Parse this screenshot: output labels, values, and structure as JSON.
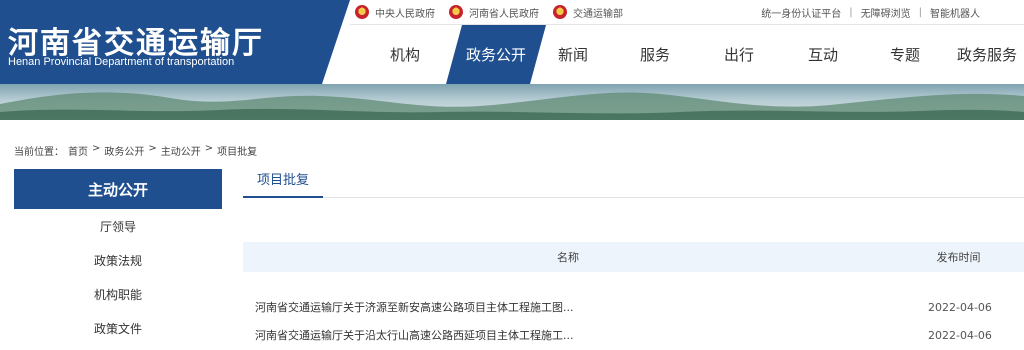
{
  "header": {
    "site_title": "河南省交通运输厅",
    "site_subtitle": "Henan Provincial Department of transportation",
    "top_links": [
      {
        "label": "中央人民政府",
        "icon": "national-emblem-icon"
      },
      {
        "label": "河南省人民政府",
        "icon": "national-emblem-icon"
      },
      {
        "label": "交通运输部",
        "icon": "national-emblem-icon"
      }
    ],
    "top_right": [
      "统一身份认证平台",
      "无障碍浏览",
      "智能机器人"
    ],
    "nav": [
      {
        "label": "机构",
        "active": false
      },
      {
        "label": "政务公开",
        "active": true
      },
      {
        "label": "新闻",
        "active": false
      },
      {
        "label": "服务",
        "active": false
      },
      {
        "label": "出行",
        "active": false
      },
      {
        "label": "互动",
        "active": false
      },
      {
        "label": "专题",
        "active": false
      },
      {
        "label": "政务服务",
        "active": false
      }
    ]
  },
  "breadcrumb": {
    "label": "当前位置：",
    "items": [
      "首页",
      "政务公开",
      "主动公开",
      "项目批复"
    ],
    "separator": ">"
  },
  "sidebar": {
    "title": "主动公开",
    "items": [
      "厅领导",
      "政策法规",
      "机构职能",
      "政策文件"
    ]
  },
  "main": {
    "tab": "项目批复",
    "table": {
      "col_name": "名称",
      "col_date": "发布时间",
      "rows": [
        {
          "title": "河南省交通运输厅关于济源至新安高速公路项目主体工程施工图...",
          "date": "2022-04-06"
        },
        {
          "title": "河南省交通运输厅关于沿太行山高速公路西延项目主体工程施工...",
          "date": "2022-04-06"
        }
      ]
    }
  },
  "colors": {
    "brand_blue": "#1f4f8f",
    "table_header_bg": "#eef4fb"
  }
}
